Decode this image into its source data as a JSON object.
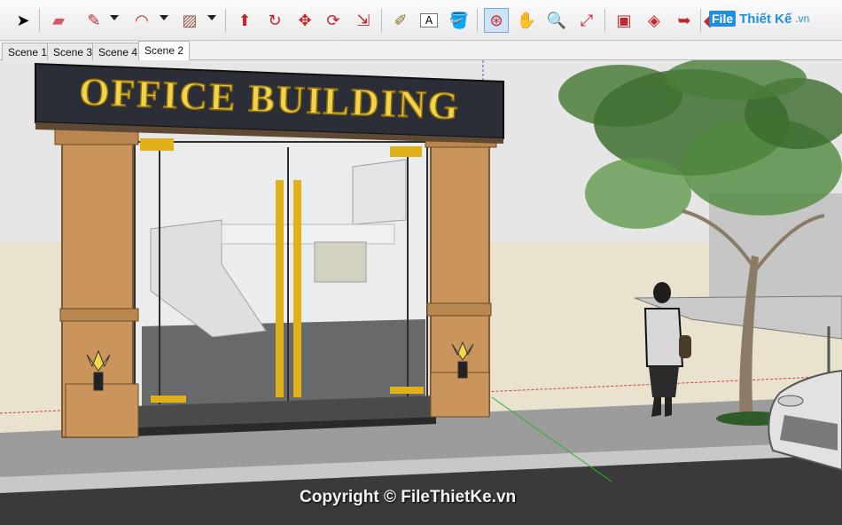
{
  "toolbar": {
    "tools": [
      {
        "icon": "select-arrow-icon",
        "glyph": "➤"
      },
      {
        "icon": "eraser-icon",
        "glyph": "▰"
      },
      {
        "icon": "pencil-line-icon",
        "glyph": "✎"
      },
      {
        "icon": "arc-icon",
        "glyph": "◠"
      },
      {
        "icon": "rectangle-shape-icon",
        "glyph": "▨"
      },
      {
        "icon": "push-pull-icon",
        "glyph": "⬆"
      },
      {
        "icon": "follow-me-icon",
        "glyph": "↻"
      },
      {
        "icon": "move-icon",
        "glyph": "✥"
      },
      {
        "icon": "rotate-icon",
        "glyph": "⟳"
      },
      {
        "icon": "scale-icon",
        "glyph": "⇲"
      },
      {
        "icon": "tape-measure-icon",
        "glyph": "✐"
      },
      {
        "icon": "text-label-icon",
        "glyph": "A"
      },
      {
        "icon": "paint-bucket-icon",
        "glyph": "🪣"
      },
      {
        "icon": "orbit-icon",
        "glyph": "⊛"
      },
      {
        "icon": "pan-hand-icon",
        "glyph": "✋"
      },
      {
        "icon": "zoom-icon",
        "glyph": "🔍"
      },
      {
        "icon": "zoom-extents-icon",
        "glyph": "⤢"
      },
      {
        "icon": "warehouse-icon",
        "glyph": "▣"
      },
      {
        "icon": "share-model-icon",
        "glyph": "◈"
      },
      {
        "icon": "export-icon",
        "glyph": "➥"
      },
      {
        "icon": "ruby-console-icon",
        "glyph": "◆"
      }
    ],
    "logo": {
      "box": "File",
      "text": "Thiết Kế",
      "tld": ".vn"
    }
  },
  "scenes": {
    "tabs": [
      "Scene 1",
      "Scene 3",
      "Scene 4",
      "Scene 2"
    ],
    "active": "Scene 2"
  },
  "model": {
    "sign_text": "OFFICE BUILDING",
    "colors": {
      "sky": "#e6e6e6",
      "ground": "#e8e2cf",
      "sign": "#2b2e36",
      "sign_text": "#f3d34a",
      "marble": "#c9955c",
      "glass_gold": "#e0b11a",
      "road": "#3a3a3a"
    }
  },
  "watermark": "Copyright © FileThietKe.vn"
}
